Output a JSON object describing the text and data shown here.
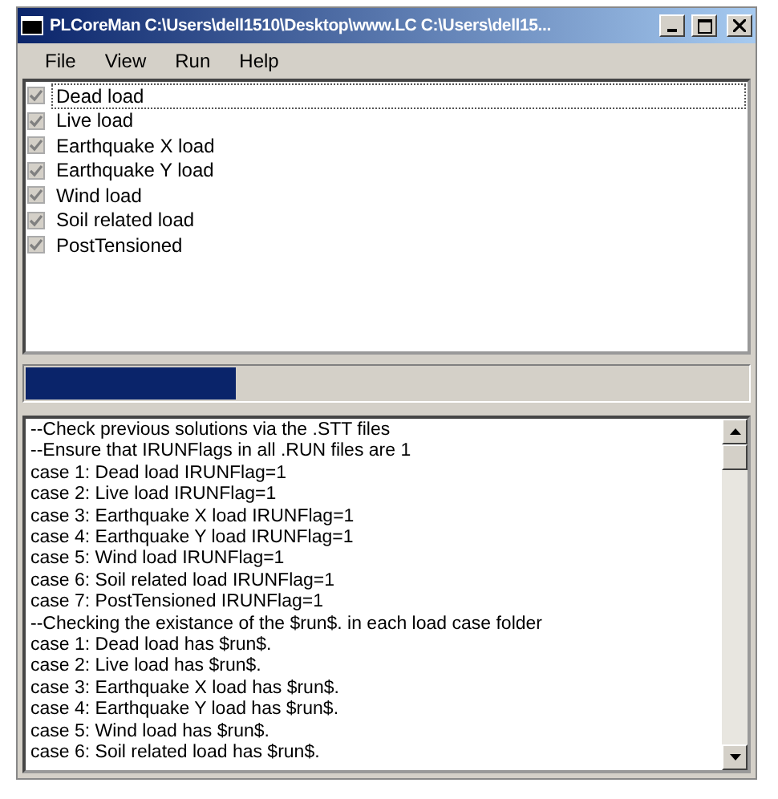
{
  "window": {
    "title": "PLCoreMan C:\\Users\\dell1510\\Desktop\\www.LC C:\\Users\\dell15..."
  },
  "menu": [
    "File",
    "View",
    "Run",
    "Help"
  ],
  "load_cases": [
    {
      "label": "Dead load",
      "checked": true,
      "disabled": true,
      "selected": true
    },
    {
      "label": "Live load",
      "checked": true,
      "disabled": true,
      "selected": false
    },
    {
      "label": "Earthquake X load",
      "checked": true,
      "disabled": true,
      "selected": false
    },
    {
      "label": "Earthquake Y load",
      "checked": true,
      "disabled": true,
      "selected": false
    },
    {
      "label": "Wind load",
      "checked": true,
      "disabled": true,
      "selected": false
    },
    {
      "label": "Soil related load",
      "checked": true,
      "disabled": true,
      "selected": false
    },
    {
      "label": "PostTensioned",
      "checked": true,
      "disabled": true,
      "selected": false
    }
  ],
  "progress": {
    "level": 0.29
  },
  "log": [
    "--Check previous solutions via the .STT files",
    "--Ensure that IRUNFlags in all .RUN files are 1",
    "case 1: Dead load IRUNFlag=1",
    "case 2: Live load IRUNFlag=1",
    "case 3: Earthquake X load IRUNFlag=1",
    "case 4: Earthquake Y load IRUNFlag=1",
    "case 5: Wind load IRUNFlag=1",
    "case 6: Soil related load IRUNFlag=1",
    "case 7: PostTensioned IRUNFlag=1",
    "--Checking the existance of the $run$. in each load case folder",
    "case 1: Dead load has $run$.",
    "case 2: Live load has $run$.",
    "case 3: Earthquake X load has $run$.",
    "case 4: Earthquake Y load has $run$.",
    "case 5: Wind load has $run$.",
    "case 6: Soil related load has $run$."
  ]
}
